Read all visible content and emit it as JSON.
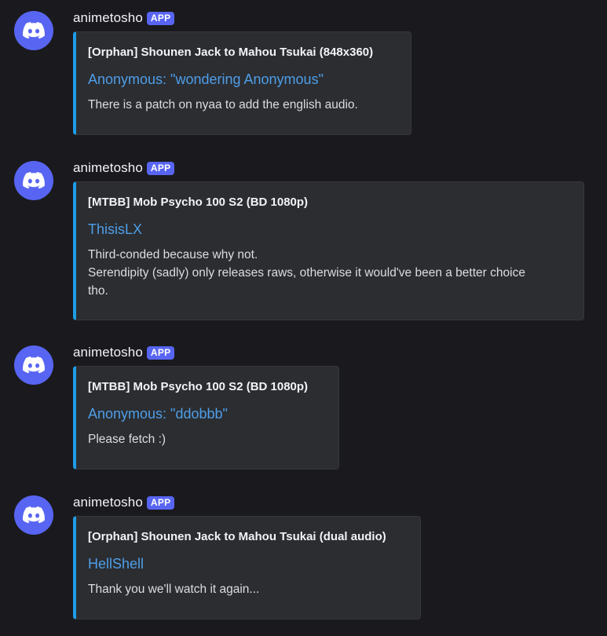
{
  "colors": {
    "background": "#1a1a1e",
    "embed_background": "#2b2d31",
    "embed_accent": "#1e9de6",
    "badge": "#5865f2",
    "author_link": "#4e9ee8",
    "avatar": "#5865f2"
  },
  "messages": [
    {
      "avatar_icon": "discord-icon",
      "username": "animetosho",
      "badge": "APP",
      "embed": {
        "title": "[Orphan] Shounen Jack to Mahou Tsukai (848x360)",
        "author": "Anonymous: \"wondering Anonymous\"",
        "description": "There is a patch on nyaa to add the english audio."
      }
    },
    {
      "avatar_icon": "discord-icon",
      "username": "animetosho",
      "badge": "APP",
      "embed": {
        "title": "[MTBB] Mob Psycho 100 S2 (BD 1080p)",
        "author": "ThisisLX",
        "description": "Third-conded because why not.\nSerendipity (sadly) only releases raws, otherwise it would've been a better choice\ntho."
      }
    },
    {
      "avatar_icon": "discord-icon",
      "username": "animetosho",
      "badge": "APP",
      "embed": {
        "title": "[MTBB] Mob Psycho 100 S2 (BD 1080p)",
        "author": "Anonymous: \"ddobbb\"",
        "description": "Please fetch :)"
      }
    },
    {
      "avatar_icon": "discord-icon",
      "username": "animetosho",
      "badge": "APP",
      "embed": {
        "title": "[Orphan] Shounen Jack to Mahou Tsukai (dual audio)",
        "author": "HellShell",
        "description": "Thank you we'll watch it again..."
      }
    }
  ]
}
